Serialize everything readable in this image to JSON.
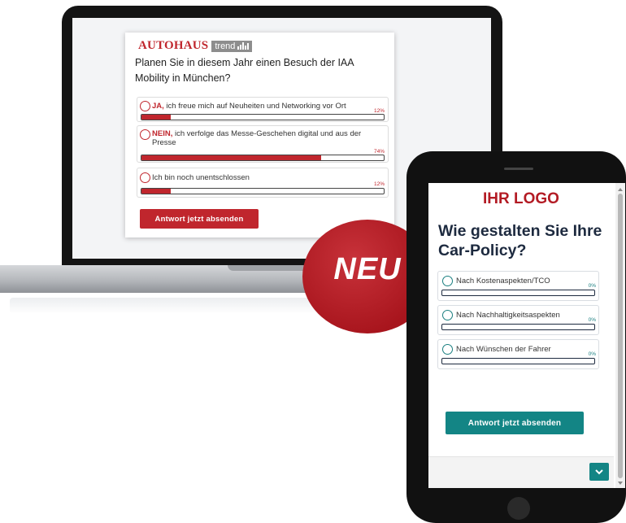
{
  "laptop_poll": {
    "brand": "AUTOHAUS",
    "brand_tag": "trend",
    "question": "Planen Sie in diesem Jahr einen Besuch der IAA Mobility in München?",
    "options": [
      {
        "prefix": "JA,",
        "text": " ich freue mich auf Neuheiten und Networking vor Ort",
        "percent_label": "12%",
        "percent": 12
      },
      {
        "prefix": "NEIN,",
        "text": " ich verfolge das Messe-Geschehen digital und aus der Presse",
        "percent_label": "74%",
        "percent": 74
      },
      {
        "prefix": "",
        "text": "Ich bin noch unentschlossen",
        "percent_label": "12%",
        "percent": 12
      }
    ],
    "submit_label": "Antwort jetzt absenden",
    "accent_color": "#c0262d"
  },
  "badge": {
    "text": "NEU",
    "color": "#b31b24"
  },
  "phone_poll": {
    "logo": "IHR LOGO",
    "question": "Wie gestalten Sie Ihre Car-Policy?",
    "options": [
      {
        "label": "Nach Kostenaspekten/TCO",
        "percent_label": "0%"
      },
      {
        "label": "Nach Nachhaltigkeitsaspekten",
        "percent_label": "0%"
      },
      {
        "label": "Nach Wünschen der Fahrer",
        "percent_label": "0%"
      }
    ],
    "submit_label": "Antwort jetzt absenden",
    "expand_icon": "chevron-down-icon",
    "accent_color": "#138585"
  }
}
